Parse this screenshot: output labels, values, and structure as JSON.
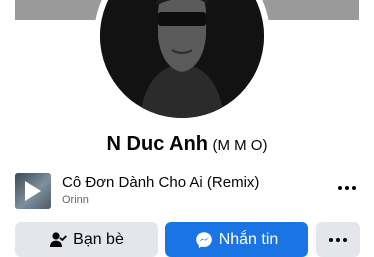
{
  "profile": {
    "name": "N Duc Anh",
    "alternate_name": "(M M O)"
  },
  "music": {
    "song_title": "Cô Đơn Dành Cho Ai (Remix)",
    "artist": "Orinn",
    "album_icon": "play-icon",
    "more_icon": "more-icon"
  },
  "actions": {
    "friends_label": "Bạn bè",
    "friends_icon": "friend-check-icon",
    "message_label": "Nhắn tin",
    "message_icon": "messenger-icon",
    "more_icon": "more-icon"
  },
  "colors": {
    "primary": "#1b74e4",
    "secondary_button": "#e4e6eb",
    "text": "#050505",
    "muted_text": "#65676b"
  }
}
